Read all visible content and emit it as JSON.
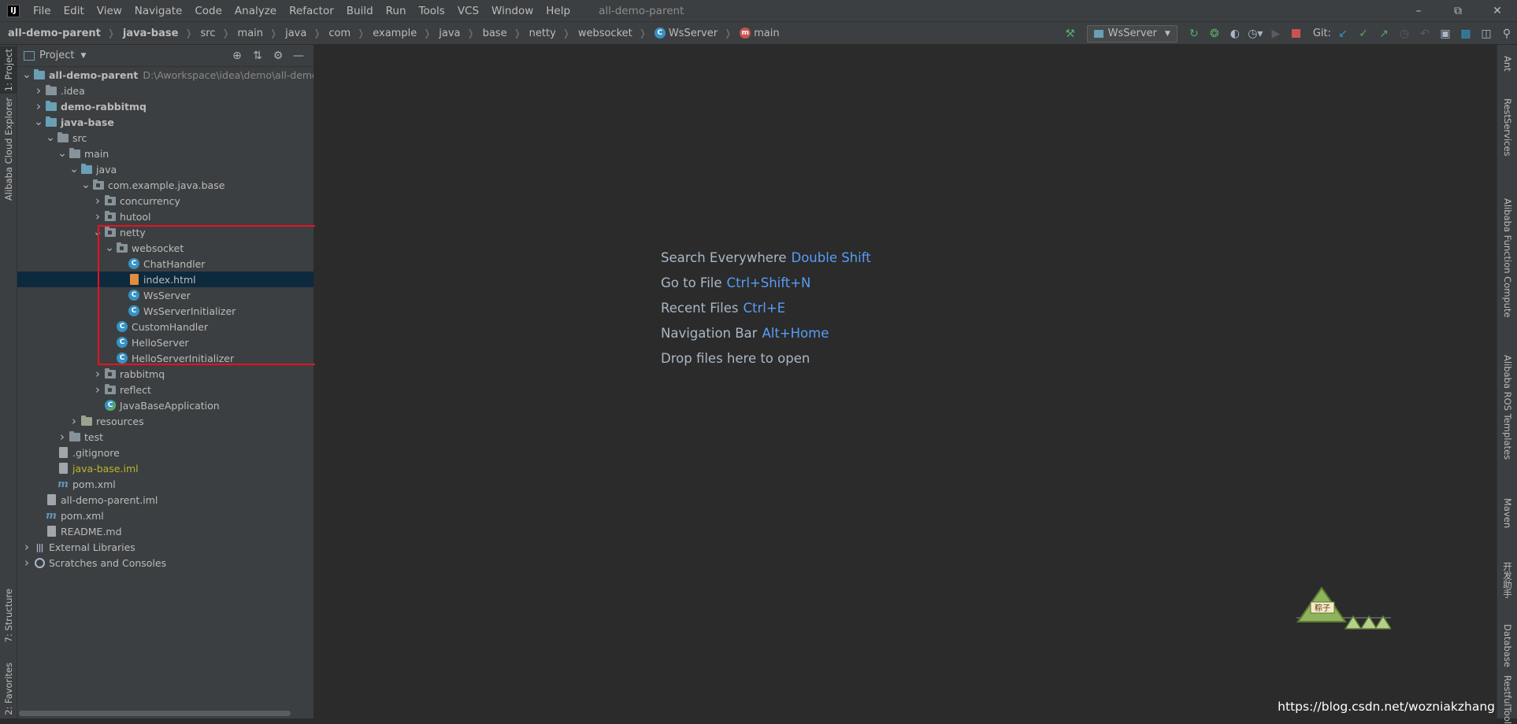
{
  "app": {
    "title": "all-demo-parent",
    "icon": "intellij-icon",
    "menu": [
      "File",
      "Edit",
      "View",
      "Navigate",
      "Code",
      "Analyze",
      "Refactor",
      "Build",
      "Run",
      "Tools",
      "VCS",
      "Window",
      "Help"
    ],
    "window_controls": [
      "minimize",
      "restore",
      "close"
    ]
  },
  "breadcrumb": [
    {
      "label": "all-demo-parent",
      "bold": true
    },
    {
      "label": "java-base",
      "bold": true
    },
    {
      "label": "src"
    },
    {
      "label": "main"
    },
    {
      "label": "java"
    },
    {
      "label": "com"
    },
    {
      "label": "example"
    },
    {
      "label": "java"
    },
    {
      "label": "base"
    },
    {
      "label": "netty"
    },
    {
      "label": "websocket"
    },
    {
      "label": "WsServer",
      "icon": "class-icon"
    },
    {
      "label": "main",
      "icon": "method-icon"
    }
  ],
  "toolbar": {
    "run_config": "WsServer",
    "git_label": "Git:"
  },
  "left_tabs": {
    "project": "1: Project",
    "cloud": "Alibaba Cloud Explorer",
    "structure": "7: Structure",
    "favorites": "2: Favorites"
  },
  "right_tabs": [
    "Ant",
    "RestServices",
    "Alibaba Function Compute",
    "Alibaba ROS Templates",
    "Maven",
    "开发助手",
    "Database",
    "RestfulTool"
  ],
  "project_panel": {
    "title": "Project",
    "tree": [
      {
        "depth": 0,
        "arrow": "down",
        "icon": "module",
        "label": "all-demo-parent",
        "bold": true,
        "path": "D:\\Aworkspace\\idea\\demo\\all-demo-p"
      },
      {
        "depth": 1,
        "arrow": "right",
        "icon": "folder",
        "label": ".idea"
      },
      {
        "depth": 1,
        "arrow": "right",
        "icon": "module",
        "label": "demo-rabbitmq",
        "bold": true
      },
      {
        "depth": 1,
        "arrow": "down",
        "icon": "module",
        "label": "java-base",
        "bold": true
      },
      {
        "depth": 2,
        "arrow": "down",
        "icon": "folder",
        "label": "src"
      },
      {
        "depth": 3,
        "arrow": "down",
        "icon": "folder",
        "label": "main"
      },
      {
        "depth": 4,
        "arrow": "down",
        "icon": "source-folder",
        "label": "java"
      },
      {
        "depth": 5,
        "arrow": "down",
        "icon": "package",
        "label": "com.example.java.base"
      },
      {
        "depth": 6,
        "arrow": "right",
        "icon": "package",
        "label": "concurrency"
      },
      {
        "depth": 6,
        "arrow": "right",
        "icon": "package",
        "label": "hutool"
      },
      {
        "depth": 6,
        "arrow": "down",
        "icon": "package",
        "label": "netty"
      },
      {
        "depth": 7,
        "arrow": "down",
        "icon": "package",
        "label": "websocket"
      },
      {
        "depth": 8,
        "arrow": "none",
        "icon": "class",
        "label": "ChatHandler"
      },
      {
        "depth": 8,
        "arrow": "none",
        "icon": "html",
        "label": "index.html",
        "selected": true
      },
      {
        "depth": 8,
        "arrow": "none",
        "icon": "class",
        "label": "WsServer"
      },
      {
        "depth": 8,
        "arrow": "none",
        "icon": "class",
        "label": "WsServerInitializer"
      },
      {
        "depth": 7,
        "arrow": "none",
        "icon": "class",
        "label": "CustomHandler"
      },
      {
        "depth": 7,
        "arrow": "none",
        "icon": "class",
        "label": "HelloServer"
      },
      {
        "depth": 7,
        "arrow": "none",
        "icon": "class",
        "label": "HelloServerInitializer"
      },
      {
        "depth": 6,
        "arrow": "right",
        "icon": "package",
        "label": "rabbitmq"
      },
      {
        "depth": 6,
        "arrow": "right",
        "icon": "package",
        "label": "reflect"
      },
      {
        "depth": 6,
        "arrow": "none",
        "icon": "app-class",
        "label": "JavaBaseApplication"
      },
      {
        "depth": 4,
        "arrow": "right",
        "icon": "resource-folder",
        "label": "resources"
      },
      {
        "depth": 3,
        "arrow": "right",
        "icon": "folder",
        "label": "test"
      },
      {
        "depth": 2,
        "arrow": "none",
        "icon": "file",
        "label": ".gitignore"
      },
      {
        "depth": 2,
        "arrow": "none",
        "icon": "iml",
        "label": "java-base.iml",
        "yellow": true
      },
      {
        "depth": 2,
        "arrow": "none",
        "icon": "maven",
        "label": "pom.xml"
      },
      {
        "depth": 1,
        "arrow": "none",
        "icon": "iml",
        "label": "all-demo-parent.iml"
      },
      {
        "depth": 1,
        "arrow": "none",
        "icon": "maven",
        "label": "pom.xml"
      },
      {
        "depth": 1,
        "arrow": "none",
        "icon": "file",
        "label": "README.md"
      },
      {
        "depth": 0,
        "arrow": "right",
        "icon": "libraries",
        "label": "External Libraries"
      },
      {
        "depth": 0,
        "arrow": "right",
        "icon": "scratches",
        "label": "Scratches and Consoles"
      }
    ]
  },
  "editor_hints": [
    {
      "text": "Search Everywhere",
      "key": "Double Shift"
    },
    {
      "text": "Go to File",
      "key": "Ctrl+Shift+N"
    },
    {
      "text": "Recent Files",
      "key": "Ctrl+E"
    },
    {
      "text": "Navigation Bar",
      "key": "Alt+Home"
    },
    {
      "text": "Drop files here to open",
      "key": ""
    }
  ],
  "mascot_text": "粽子",
  "watermark": "https://blog.csdn.net/wozniakzhang",
  "colors": {
    "background": "#2b2b2b",
    "panel": "#3c3f41",
    "selection": "#0d293e",
    "highlight_box": "#e81123",
    "shortcut": "#589df6"
  }
}
